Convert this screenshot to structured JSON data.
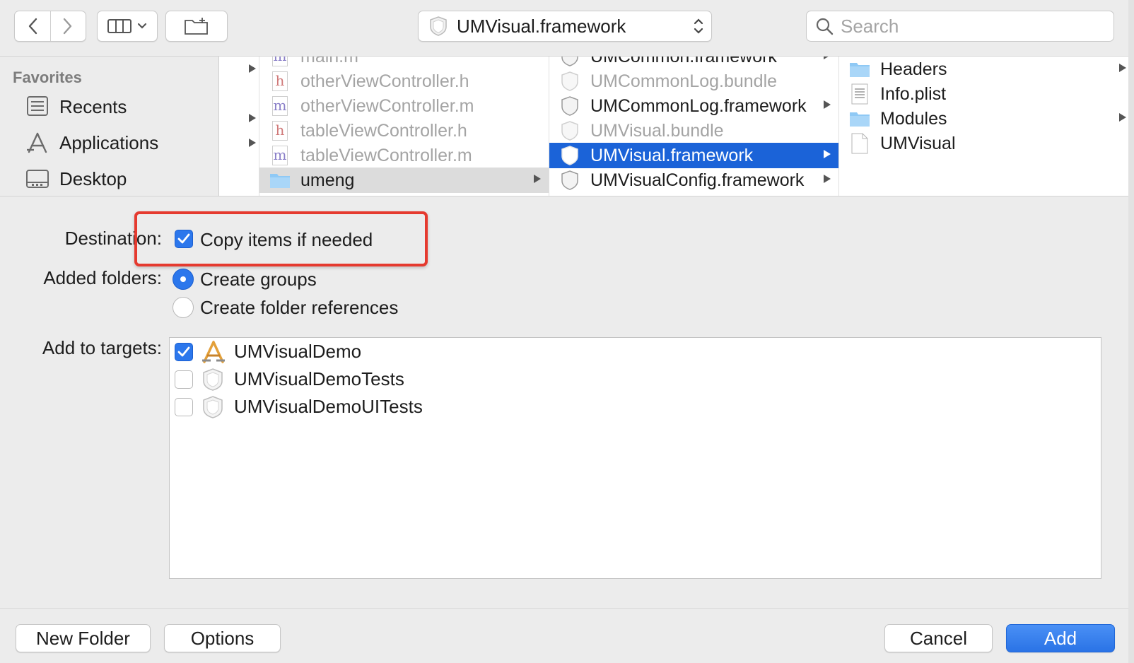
{
  "toolbar": {
    "path_label": "UMVisual.framework",
    "search_placeholder": "Search"
  },
  "sidebar": {
    "heading": "Favorites",
    "items": [
      {
        "label": "Recents",
        "icon": "recents-icon"
      },
      {
        "label": "Applications",
        "icon": "applications-icon"
      },
      {
        "label": "Desktop",
        "icon": "desktop-icon"
      }
    ]
  },
  "columns": {
    "col2": [
      {
        "label": "main.m",
        "type": "m",
        "dim": true
      },
      {
        "label": "otherViewController.h",
        "type": "h",
        "dim": true
      },
      {
        "label": "otherViewController.m",
        "type": "m",
        "dim": true
      },
      {
        "label": "tableViewController.h",
        "type": "h",
        "dim": true
      },
      {
        "label": "tableViewController.m",
        "type": "m",
        "dim": true
      },
      {
        "label": "umeng",
        "type": "folder",
        "dim": false,
        "selected": true
      }
    ],
    "col3": [
      {
        "label": "UMCommon.framework",
        "dim": false
      },
      {
        "label": "UMCommonLog.bundle",
        "dim": true
      },
      {
        "label": "UMCommonLog.framework",
        "dim": false
      },
      {
        "label": "UMVisual.bundle",
        "dim": true
      },
      {
        "label": "UMVisual.framework",
        "dim": false,
        "selected": true
      },
      {
        "label": "UMVisualConfig.framework",
        "dim": false
      }
    ],
    "col4": [
      {
        "label": "Headers",
        "type": "folder"
      },
      {
        "label": "Info.plist",
        "type": "plist"
      },
      {
        "label": "Modules",
        "type": "folder"
      },
      {
        "label": "UMVisual",
        "type": "file"
      }
    ]
  },
  "options": {
    "destination_label": "Destination:",
    "copy_items_label": "Copy items if needed",
    "copy_items_checked": true,
    "added_folders_label": "Added folders:",
    "create_groups_label": "Create groups",
    "create_folder_refs_label": "Create folder references",
    "selected_folder_option": "Create groups",
    "add_to_targets_label": "Add to targets:",
    "targets": [
      {
        "name": "UMVisualDemo",
        "checked": true,
        "icon": "app-target-icon"
      },
      {
        "name": "UMVisualDemoTests",
        "checked": false,
        "icon": "test-target-icon"
      },
      {
        "name": "UMVisualDemoUITests",
        "checked": false,
        "icon": "test-target-icon"
      }
    ]
  },
  "buttons": {
    "new_folder": "New Folder",
    "options": "Options",
    "cancel": "Cancel",
    "add": "Add"
  },
  "colors": {
    "accent": "#2c77ec",
    "selection": "#1b63d8",
    "highlight_box": "#e53a2f"
  }
}
